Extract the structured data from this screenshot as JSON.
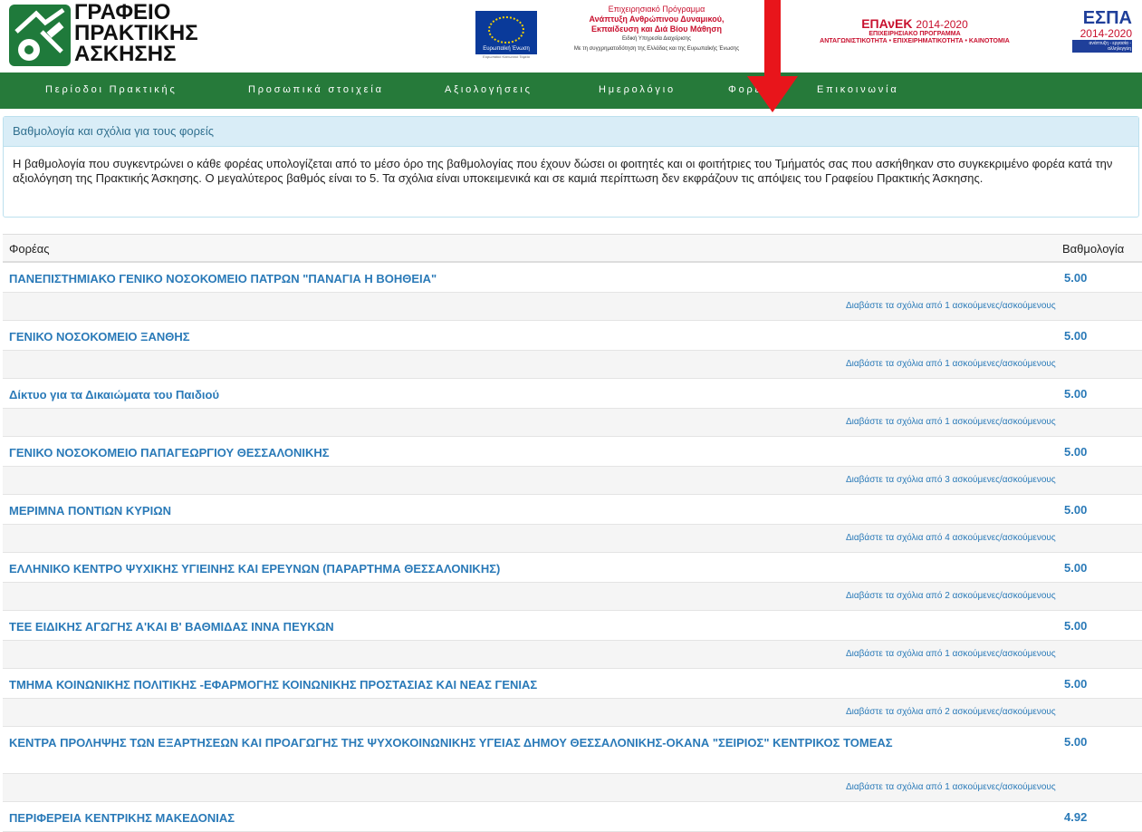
{
  "brand": {
    "logo_lines": [
      "ΓΡΑΦΕΙΟ",
      "ΠΡΑΚΤΙΚΗΣ",
      "ΑΣΚΗΣΗΣ"
    ],
    "eu_caption": "Ευρωπαϊκή Ένωση",
    "eu_sub": "Ευρωπαϊκό Κοινωνικό Ταμείο",
    "program_lines": [
      "Επιχειρησιακό Πρόγραμμα",
      "Ανάπτυξη Ανθρώπινου Δυναμικού,",
      "Εκπαίδευση και Διά Βίου Μάθηση"
    ],
    "program_small": [
      "Ειδική Υπηρεσία Διαχείρισης",
      "Με τη συγχρηματοδότηση της Ελλάδας και της Ευρωπαϊκής Ένωσης"
    ],
    "epanek_title": "ΕΠΑνΕΚ",
    "epanek_years": "2014-2020",
    "epanek_sub1": "ΕΠΙΧΕΙΡΗΣΙΑΚΟ ΠΡΟΓΡΑΜΜΑ",
    "epanek_sub2": "ΑΝΤΑΓΩΝΙΣΤΙΚΟΤΗΤΑ • ΕΠΙΧΕΙΡΗΜΑΤΙΚΟΤΗΤΑ • ΚΑΙΝΟΤΟΜΙΑ",
    "espa_title": "ΕΣΠΑ",
    "espa_years": "2014-2020",
    "espa_tag": "ανάπτυξη - εργασία - αλληλεγγύη"
  },
  "nav": {
    "items": [
      "Περίοδοι Πρακτικής",
      "Προσωπικά στοιχεία",
      "Αξιολογήσεις",
      "Ημερολόγιο",
      "Φορείς",
      "Επικοινωνία"
    ]
  },
  "panel": {
    "title": "Βαθμολογία και σχόλια για τους φορείς",
    "body": "Η βαθμολογία που συγκεντρώνει ο κάθε φορέας υπολογίζεται από το μέσο όρο της βαθμολογίας που έχουν δώσει οι φοιτητές και οι φοιτήτριες του Τμήματός σας που ασκήθηκαν στο συγκεκριμένο φορέα κατά την αξιολόγηση της Πρακτικής Άσκησης. Ο μεγαλύτερος βαθμός είναι το 5. Τα σχόλια είναι υποκειμενικά και σε καμιά περίπτωση δεν εκφράζουν τις απόψεις του Γραφείου Πρακτικής Άσκησης."
  },
  "table": {
    "col_name": "Φορέας",
    "col_score": "Βαθμολογία",
    "rows": [
      {
        "name": "ΠΑΝΕΠΙΣΤΗΜΙΑΚΟ ΓΕΝΙΚΟ ΝΟΣΟΚΟΜΕΙΟ ΠΑΤΡΩΝ \"ΠΑΝΑΓΙΑ Η ΒΟΗΘΕΙΑ\"",
        "score": "5.00",
        "comments": "Διαβάστε τα σχόλια από 1 ασκούμενες/ασκούμενους"
      },
      {
        "name": "ΓΕΝΙΚΟ ΝΟΣΟΚΟΜΕΙΟ ΞΑΝΘΗΣ",
        "score": "5.00",
        "comments": "Διαβάστε τα σχόλια από 1 ασκούμενες/ασκούμενους"
      },
      {
        "name": "Δίκτυο για τα Δικαιώματα του Παιδιού",
        "score": "5.00",
        "comments": "Διαβάστε τα σχόλια από 1 ασκούμενες/ασκούμενους"
      },
      {
        "name": "ΓΕΝΙΚΟ ΝΟΣΟΚΟΜΕΙΟ ΠΑΠΑΓΕΩΡΓΙΟΥ ΘΕΣΣΑΛΟΝΙΚΗΣ",
        "score": "5.00",
        "comments": "Διαβάστε τα σχόλια από 3 ασκούμενες/ασκούμενους"
      },
      {
        "name": "ΜΕΡΙΜΝΑ ΠΟΝΤΙΩΝ ΚΥΡΙΩΝ",
        "score": "5.00",
        "comments": "Διαβάστε τα σχόλια από 4 ασκούμενες/ασκούμενους"
      },
      {
        "name": "ΕΛΛΗΝΙΚΟ ΚΕΝΤΡΟ ΨΥΧΙΚΗΣ ΥΓΙΕΙΝΗΣ ΚΑΙ ΕΡΕΥΝΩΝ (ΠΑΡΑΡΤΗΜΑ ΘΕΣΣΑΛΟΝΙΚΗΣ)",
        "score": "5.00",
        "comments": "Διαβάστε τα σχόλια από 2 ασκούμενες/ασκούμενους"
      },
      {
        "name": "ΤΕΕ ΕΙΔΙΚΗΣ ΑΓΩΓΗΣ Α'ΚΑΙ Β' ΒΑΘΜΙΔΑΣ ΙΝΝΑ ΠΕΥΚΩΝ",
        "score": "5.00",
        "comments": "Διαβάστε τα σχόλια από 1 ασκούμενες/ασκούμενους"
      },
      {
        "name": "ΤΜΗΜΑ ΚΟΙΝΩΝΙΚΗΣ ΠΟΛΙΤΙΚΗΣ -ΕΦΑΡΜΟΓΗΣ ΚΟΙΝΩΝΙΚΗΣ ΠΡΟΣΤΑΣΙΑΣ ΚΑΙ ΝΕΑΣ ΓΕΝΙΑΣ",
        "score": "5.00",
        "comments": "Διαβάστε τα σχόλια από 2 ασκούμενες/ασκούμενους"
      },
      {
        "name": "ΚΕΝΤΡΑ ΠΡΟΛΗΨΗΣ ΤΩΝ ΕΞΑΡΤΗΣΕΩΝ ΚΑΙ ΠΡΟΑΓΩΓΗΣ ΤΗΣ ΨΥΧΟΚΟΙΝΩΝΙΚΗΣ ΥΓΕΙΑΣ ΔΗΜΟΥ ΘΕΣΣΑΛΟΝΙΚΗΣ-ΟΚΑΝΑ \"ΣΕΙΡΙΟΣ\" ΚΕΝΤΡΙΚΟΣ ΤΟΜΕΑΣ",
        "score": "5.00",
        "comments": "Διαβάστε τα σχόλια από 1 ασκούμενες/ασκούμενους"
      },
      {
        "name": "ΠΕΡΙΦΕΡΕΙΑ ΚΕΝΤΡΙΚΗΣ ΜΑΚΕΔΟΝΙΑΣ",
        "score": "4.92",
        "comments": ""
      }
    ]
  },
  "colors": {
    "nav_bg": "#267a3a",
    "link": "#2a7ab8",
    "panel_head_bg": "#d9edf7",
    "arrow": "#e8151b"
  }
}
